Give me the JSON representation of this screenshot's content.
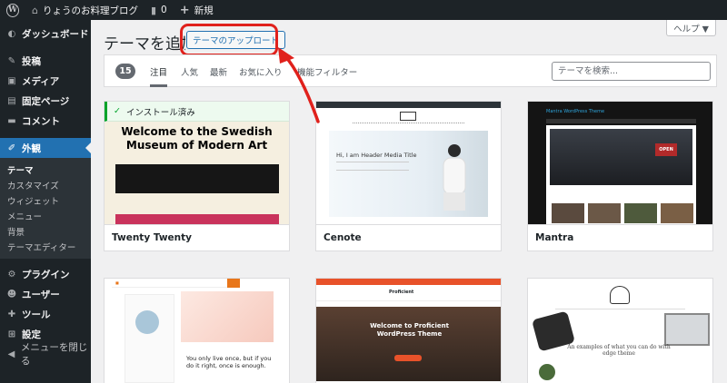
{
  "adminbar": {
    "site_name": "りょうのお料理ブログ",
    "comments_count": "0",
    "new_label": "新規"
  },
  "sidebar": {
    "items": [
      {
        "label": "ダッシュボード",
        "icon": "dashboard-icon"
      },
      {
        "label": "投稿",
        "icon": "pin-icon"
      },
      {
        "label": "メディア",
        "icon": "media-icon"
      },
      {
        "label": "固定ページ",
        "icon": "page-icon"
      },
      {
        "label": "コメント",
        "icon": "comment-icon"
      },
      {
        "label": "外観",
        "icon": "brush-icon",
        "current": true
      },
      {
        "label": "プラグイン",
        "icon": "plugin-icon"
      },
      {
        "label": "ユーザー",
        "icon": "user-icon"
      },
      {
        "label": "ツール",
        "icon": "tool-icon"
      },
      {
        "label": "設定",
        "icon": "settings-icon"
      },
      {
        "label": "メニューを閉じる",
        "icon": "collapse-icon"
      }
    ],
    "appearance_submenu": [
      "テーマ",
      "カスタマイズ",
      "ウィジェット",
      "メニュー",
      "背景",
      "テーマエディター"
    ]
  },
  "header": {
    "title": "テーマを追加",
    "upload_button": "テーマのアップロード",
    "help_label": "ヘルプ ▼"
  },
  "filter": {
    "count": "15",
    "tabs": [
      "注目",
      "人気",
      "最新",
      "お気に入り"
    ],
    "feature_filter": "機能フィルター",
    "search_placeholder": "テーマを検索..."
  },
  "themes": [
    {
      "name": "Twenty Twenty",
      "installed_label": "インストール済み",
      "preview_title": "Welcome to the Swedish Museum of Modern Art"
    },
    {
      "name": "Cenote",
      "preview_title": "Hi, I am Header Media Title"
    },
    {
      "name": "Mantra",
      "preview_title": "Mantra WordPress Theme"
    },
    {
      "name": "",
      "preview_title": "You only live once, but if you do it right, once is enough."
    },
    {
      "name": "",
      "preview_title": "Welcome to Proficient WordPress Theme"
    },
    {
      "name": "",
      "preview_title": "An examples of what you can do with edge theme"
    }
  ],
  "colors": {
    "accent": "#2271b1",
    "admin_dark": "#1d2327",
    "highlight": "#e0211c",
    "installed_green": "#00a32a"
  }
}
